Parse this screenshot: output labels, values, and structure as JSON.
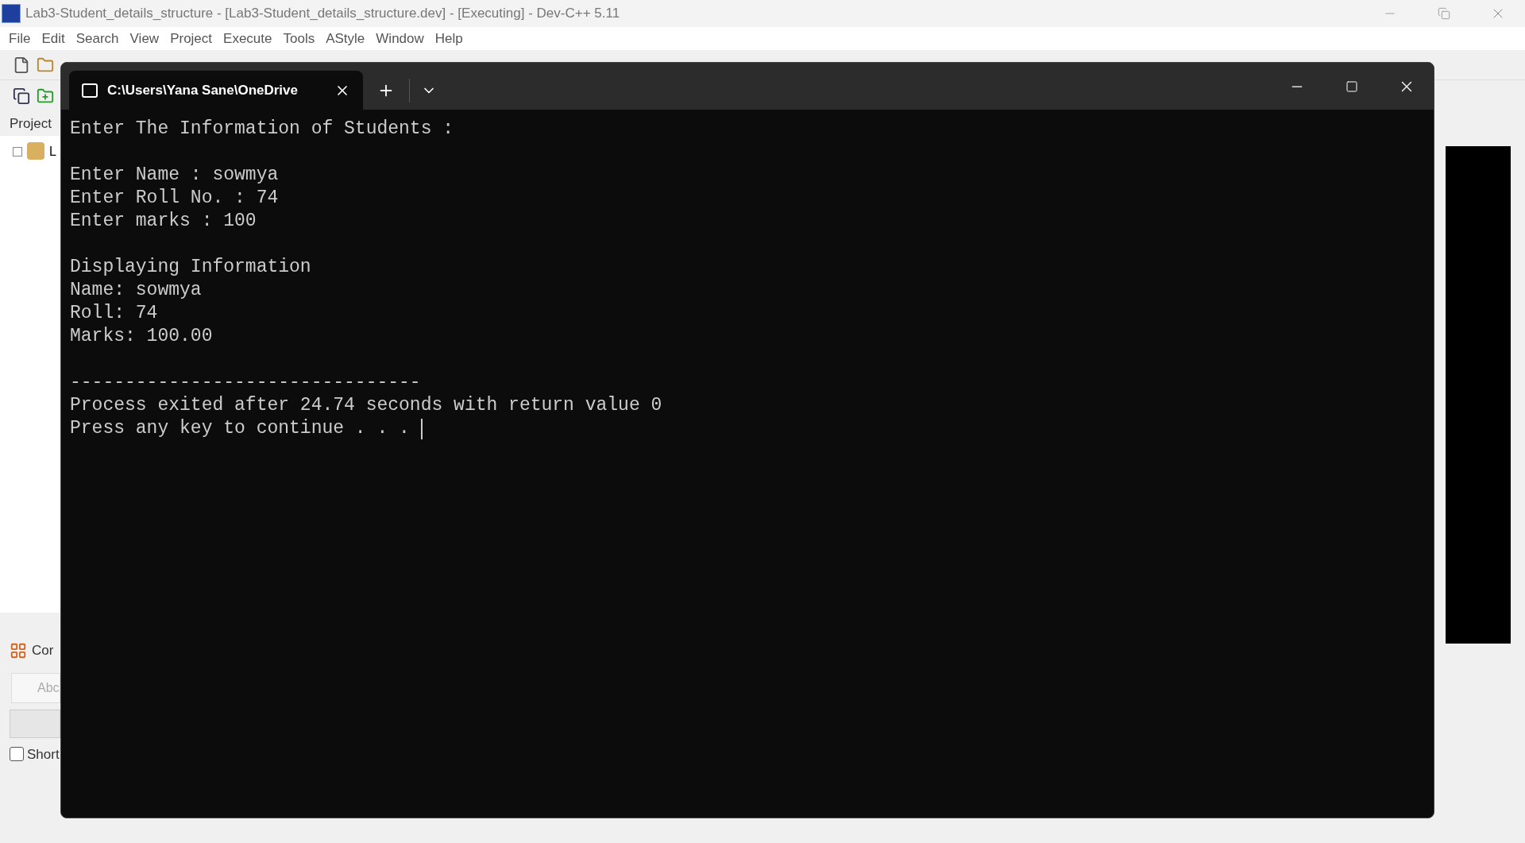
{
  "ide": {
    "title": "Lab3-Student_details_structure - [Lab3-Student_details_structure.dev] - [Executing] - Dev-C++ 5.11",
    "menu": [
      "File",
      "Edit",
      "Search",
      "View",
      "Project",
      "Execute",
      "Tools",
      "AStyle",
      "Window",
      "Help"
    ],
    "project_tab": "Project",
    "tree_item": "L",
    "bottom_tab": "Cor",
    "search_placeholder": "Abc",
    "checkbox": {
      "label": "Short",
      "checked": false
    }
  },
  "terminal": {
    "tab_title": "C:\\Users\\Yana Sane\\OneDrive",
    "blocks": [
      [
        "Enter The Information of Students :"
      ],
      [
        "Enter Name : sowmya",
        "Enter Roll No. : 74",
        "Enter marks : 100"
      ],
      [
        "Displaying Information",
        "Name: sowmya",
        "Roll: 74",
        "Marks: 100.00"
      ],
      [
        "--------------------------------",
        "Process exited after 24.74 seconds with return value 0",
        "Press any key to continue . . ."
      ]
    ],
    "cursor_visible": true
  }
}
